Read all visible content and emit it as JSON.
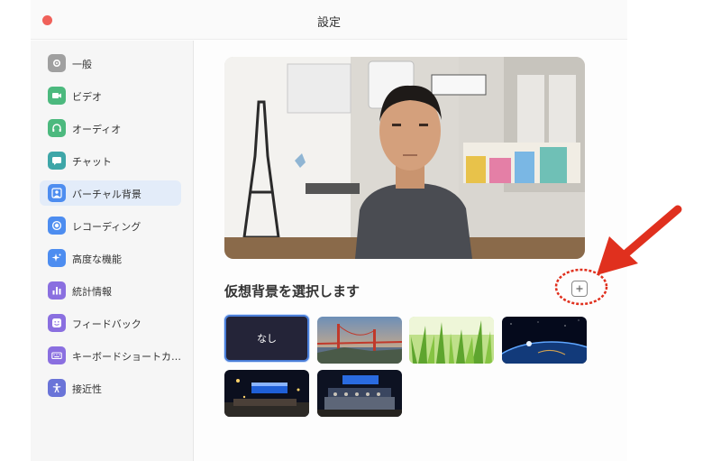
{
  "window": {
    "title": "設定"
  },
  "sidebar": {
    "items": [
      {
        "label": "一般",
        "icon": "gear-icon",
        "color": "#a0a0a0"
      },
      {
        "label": "ビデオ",
        "icon": "video-camera-icon",
        "color": "#4cb97e"
      },
      {
        "label": "オーディオ",
        "icon": "headphones-icon",
        "color": "#4cb97e"
      },
      {
        "label": "チャット",
        "icon": "chat-bubble-icon",
        "color": "#3ea6a8"
      },
      {
        "label": "バーチャル背景",
        "icon": "person-background-icon",
        "color": "#4d8df0",
        "active": true
      },
      {
        "label": "レコーディング",
        "icon": "record-icon",
        "color": "#4d8df0"
      },
      {
        "label": "高度な機能",
        "icon": "sparkle-icon",
        "color": "#4d8df0"
      },
      {
        "label": "統計情報",
        "icon": "bar-chart-icon",
        "color": "#8a6fe0"
      },
      {
        "label": "フィードバック",
        "icon": "smiley-icon",
        "color": "#8a6fe0"
      },
      {
        "label": "キーボードショートカ…",
        "icon": "keyboard-icon",
        "color": "#8a6fe0"
      },
      {
        "label": "接近性",
        "icon": "accessibility-icon",
        "color": "#6a74d8"
      }
    ]
  },
  "main": {
    "preview_alt": "camera-preview",
    "heading": "仮想背景を選択します",
    "add_button_icon": "plus-square-icon",
    "backgrounds": [
      {
        "label": "なし",
        "kind": "none",
        "selected": true
      },
      {
        "label": "",
        "kind": "golden-gate-bridge"
      },
      {
        "label": "",
        "kind": "grass"
      },
      {
        "label": "",
        "kind": "earth-from-space"
      },
      {
        "label": "",
        "kind": "night-event-1"
      },
      {
        "label": "",
        "kind": "night-event-2"
      }
    ]
  },
  "annotation": {
    "arrow_color": "#e0301e",
    "circle_color": "#e0301e"
  }
}
